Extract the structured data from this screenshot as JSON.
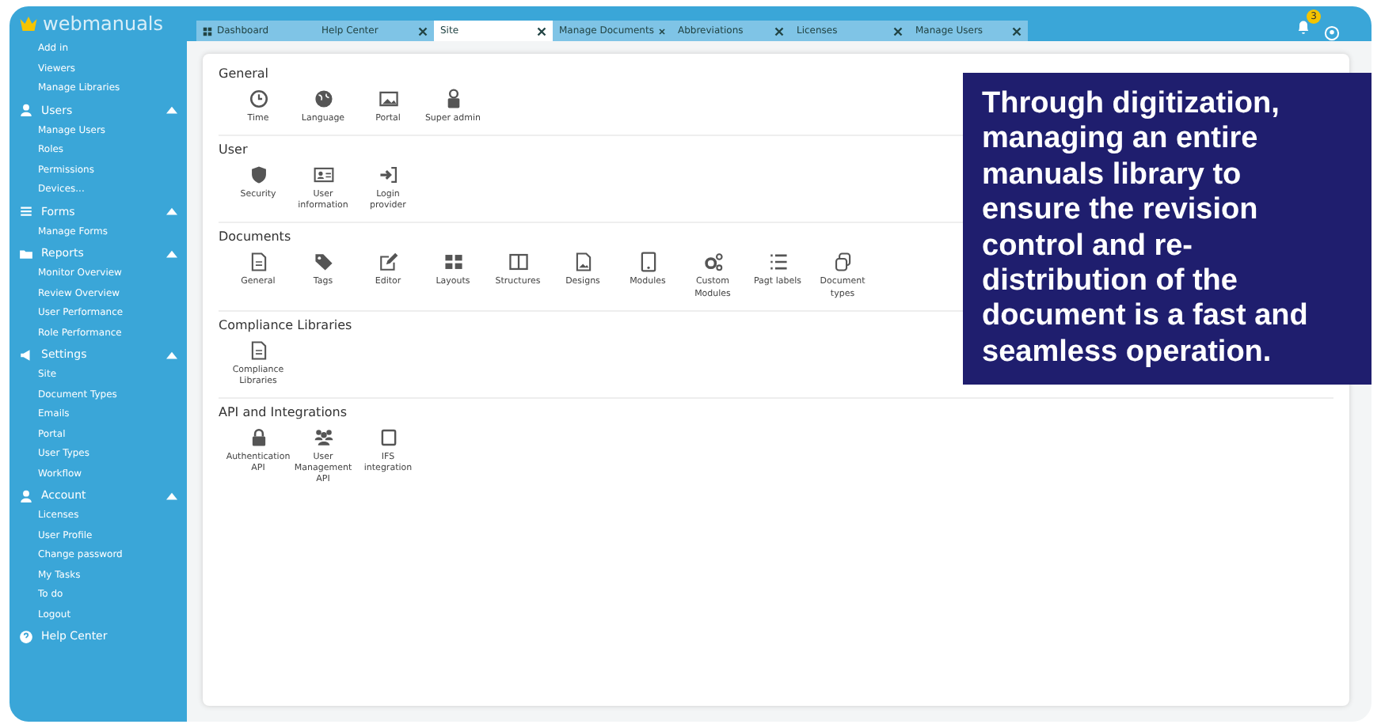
{
  "brand": {
    "name": "webmanuals"
  },
  "sidebar": {
    "items": [
      {
        "label": "Add in",
        "kind": "link"
      },
      {
        "label": "Viewers",
        "kind": "link"
      },
      {
        "label": "Manage Libraries",
        "kind": "link"
      },
      {
        "label": "Users",
        "kind": "group",
        "expanded": true,
        "children": [
          {
            "label": "Manage Users"
          },
          {
            "label": "Roles"
          },
          {
            "label": "Permissions"
          },
          {
            "label": "Devices..."
          }
        ]
      },
      {
        "label": "Forms",
        "kind": "group",
        "expanded": true,
        "children": [
          {
            "label": "Manage Forms"
          }
        ]
      },
      {
        "label": "Reports",
        "kind": "group",
        "expanded": true,
        "children": [
          {
            "label": "Monitor Overview"
          },
          {
            "label": "Review Overview"
          },
          {
            "label": "User Performance"
          },
          {
            "label": "Role Performance"
          }
        ]
      },
      {
        "label": "Settings",
        "kind": "group",
        "expanded": true,
        "children": [
          {
            "label": "Site"
          },
          {
            "label": "Document Types"
          },
          {
            "label": "Emails"
          },
          {
            "label": "Portal"
          },
          {
            "label": "User Types"
          },
          {
            "label": "Workflow"
          }
        ]
      },
      {
        "label": "Account",
        "kind": "group",
        "expanded": true,
        "children": [
          {
            "label": "Licenses"
          },
          {
            "label": "User Profile"
          },
          {
            "label": "Change password"
          },
          {
            "label": "My Tasks"
          },
          {
            "label": "To do"
          },
          {
            "label": "Logout"
          }
        ]
      },
      {
        "label": "Help Center",
        "kind": "footer"
      }
    ]
  },
  "tabs": [
    {
      "label": "Dashboard",
      "kind": "pinned",
      "selected": false
    },
    {
      "label": "Help Center",
      "kind": "closable",
      "selected": false
    },
    {
      "label": "Site",
      "kind": "closable",
      "selected": true
    },
    {
      "label": "Manage Documents",
      "kind": "closable",
      "selected": false
    },
    {
      "label": "Abbreviations",
      "kind": "closable",
      "selected": false
    },
    {
      "label": "Licenses",
      "kind": "closable",
      "selected": false
    },
    {
      "label": "Manage Users",
      "kind": "closable",
      "selected": false
    }
  ],
  "notifications": {
    "count": "3"
  },
  "sections": [
    {
      "title": "General",
      "items": [
        "Time",
        "Language",
        "Portal",
        "Super admin"
      ]
    },
    {
      "title": "User",
      "items": [
        "Security",
        "User information",
        "Login provider"
      ]
    },
    {
      "title": "Documents",
      "items": [
        "General",
        "Tags",
        "Editor",
        "Layouts",
        "Structures",
        "Designs",
        "Modules",
        "Custom Modules",
        "Pagt labels",
        "Document types"
      ]
    },
    {
      "title": "Compliance Libraries",
      "items": [
        "Compliance Libraries"
      ]
    },
    {
      "title": "API and Integrations",
      "items": [
        "Authentication API",
        "User Management API",
        "IFS integration"
      ]
    }
  ],
  "callout": {
    "text": "Through digitization, managing an entire manuals library to ensure the revision control and re-distribution of the document is a fast and seamless operation."
  }
}
